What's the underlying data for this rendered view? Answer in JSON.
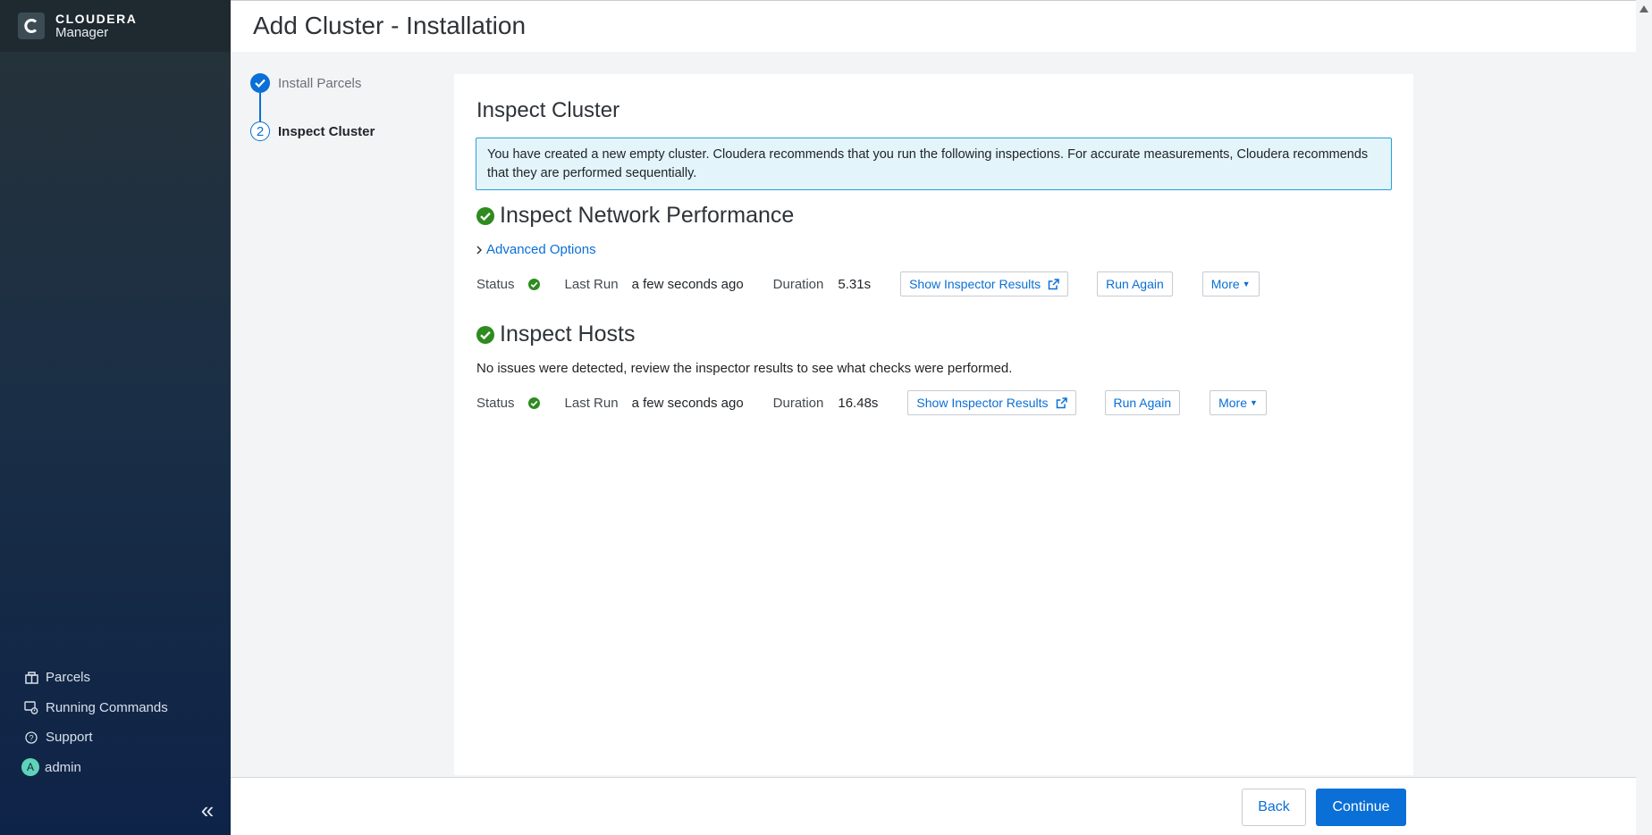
{
  "brand": {
    "top": "CLOUDERA",
    "bottom": "Manager",
    "logo_icon": "cloudera-logo-icon"
  },
  "sidebar": {
    "items": [
      {
        "label": "Parcels",
        "icon": "parcels-icon"
      },
      {
        "label": "Running Commands",
        "icon": "running-commands-icon"
      },
      {
        "label": "Support",
        "icon": "help-circle-icon"
      },
      {
        "label": "admin",
        "icon": "avatar",
        "avatar_letter": "A"
      }
    ],
    "collapse_icon": "double-chevron-left-icon"
  },
  "page": {
    "title": "Add Cluster - Installation"
  },
  "steps": [
    {
      "label": "Install Parcels",
      "state": "done"
    },
    {
      "number": "2",
      "label": "Inspect Cluster",
      "state": "active"
    }
  ],
  "card": {
    "title": "Inspect Cluster",
    "alert": "You have created a new empty cluster. Cloudera recommends that you run the following inspections. For accurate measurements, Cloudera recommends that they are performed sequentially."
  },
  "network": {
    "title": "Inspect Network Performance",
    "advanced_label": "Advanced Options",
    "status_label": "Status",
    "last_run_label": "Last Run",
    "last_run_value": "a few seconds ago",
    "duration_label": "Duration",
    "duration_value": "5.31s",
    "show_results_label": "Show Inspector Results",
    "run_again_label": "Run Again",
    "more_label": "More"
  },
  "hosts": {
    "title": "Inspect Hosts",
    "description": "No issues were detected, review the inspector results to see what checks were performed.",
    "status_label": "Status",
    "last_run_label": "Last Run",
    "last_run_value": "a few seconds ago",
    "duration_label": "Duration",
    "duration_value": "16.48s",
    "show_results_label": "Show Inspector Results",
    "run_again_label": "Run Again",
    "more_label": "More"
  },
  "footer": {
    "back_label": "Back",
    "continue_label": "Continue"
  },
  "colors": {
    "primary": "#0a6fd6",
    "success": "#2e8b1f",
    "alert_bg": "#e3f4fb",
    "alert_border": "#2a9fd8"
  }
}
